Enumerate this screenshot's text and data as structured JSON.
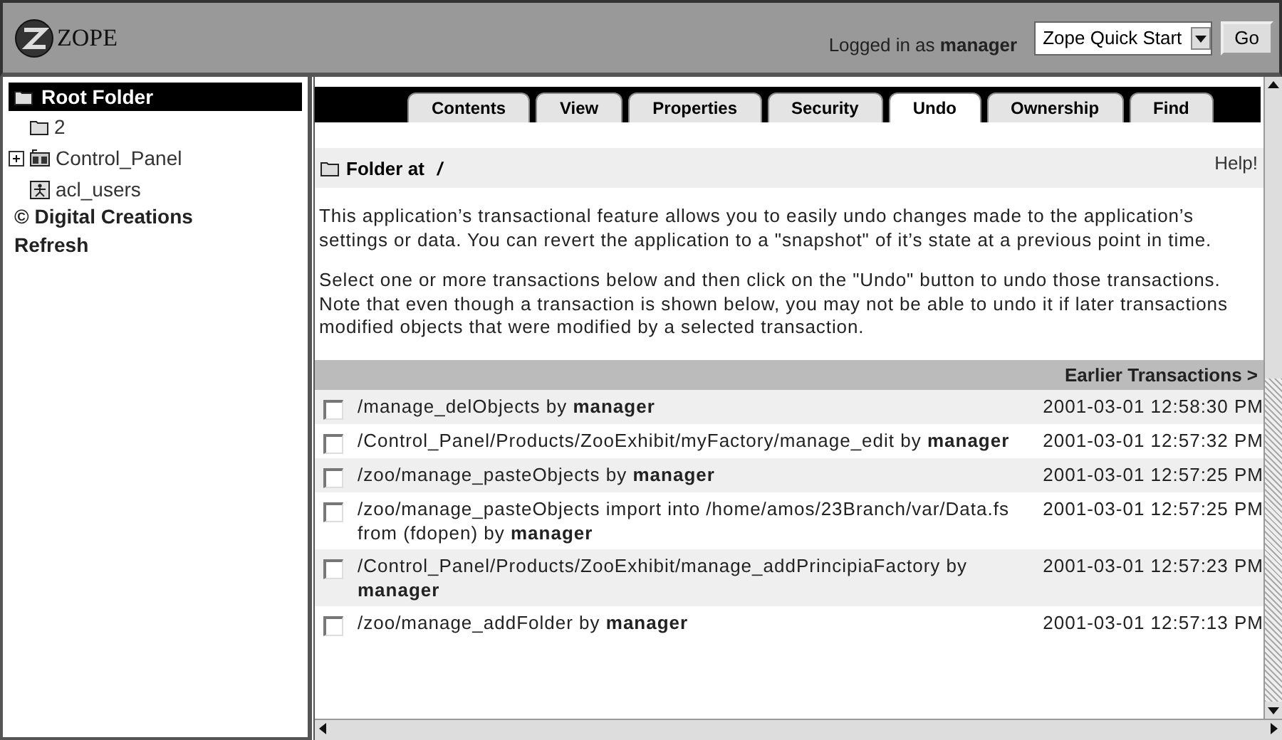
{
  "header": {
    "logo_text": "ZOPE",
    "login_label": "Logged in as",
    "user": "manager",
    "quick_start": {
      "value": "Zope Quick Start"
    },
    "go_button": "Go"
  },
  "tree": {
    "root": "Root Folder",
    "items": [
      {
        "label": "2",
        "kind": "folder",
        "expandable": false
      },
      {
        "label": "Control_Panel",
        "kind": "panel",
        "expandable": true
      },
      {
        "label": "acl_users",
        "kind": "users",
        "expandable": false
      }
    ],
    "copyright": "© Digital Creations",
    "refresh": "Refresh"
  },
  "tabs": [
    {
      "label": "Contents",
      "selected": false
    },
    {
      "label": "View",
      "selected": false
    },
    {
      "label": "Properties",
      "selected": false
    },
    {
      "label": "Security",
      "selected": false
    },
    {
      "label": "Undo",
      "selected": true
    },
    {
      "label": "Ownership",
      "selected": false
    },
    {
      "label": "Find",
      "selected": false
    }
  ],
  "location": {
    "label": "Folder at",
    "path": "/",
    "help": "Help!"
  },
  "paragraphs": [
    "This application’s transactional feature allows you to easily undo changes made to the application’s settings or data. You can revert the application to a \"snapshot\" of it’s state at a previous point in time.",
    "Select one or more transactions below and then click on the \"Undo\" button to undo those transactions. Note that even though a transaction is shown below, you may not be able to undo it if later transactions modified objects that were modified by a selected transaction."
  ],
  "earlier_link": "Earlier Transactions >",
  "transactions": [
    {
      "description": "/manage_delObjects by **manager**",
      "time": "2001-03-01 12:58:30 PM",
      "checked": false
    },
    {
      "description": "/Control_Panel/Products/ZooExhibit/myFactory/manage_edit by **manager**",
      "time": "2001-03-01 12:57:32 PM",
      "checked": false
    },
    {
      "description": "/zoo/manage_pasteObjects by **manager**",
      "time": "2001-03-01 12:57:25 PM",
      "checked": false
    },
    {
      "description": "/zoo/manage_pasteObjects import into /home/amos/23Branch/var/Data.fs from (fdopen) by **manager**",
      "time": "2001-03-01 12:57:25 PM",
      "checked": false
    },
    {
      "description": "/Control_Panel/Products/ZooExhibit/manage_addPrincipiaFactory by **manager**",
      "time": "2001-03-01 12:57:23 PM",
      "checked": false
    },
    {
      "description": "/zoo/manage_addFolder by **manager**",
      "time": "2001-03-01 12:57:13 PM",
      "checked": false
    }
  ]
}
